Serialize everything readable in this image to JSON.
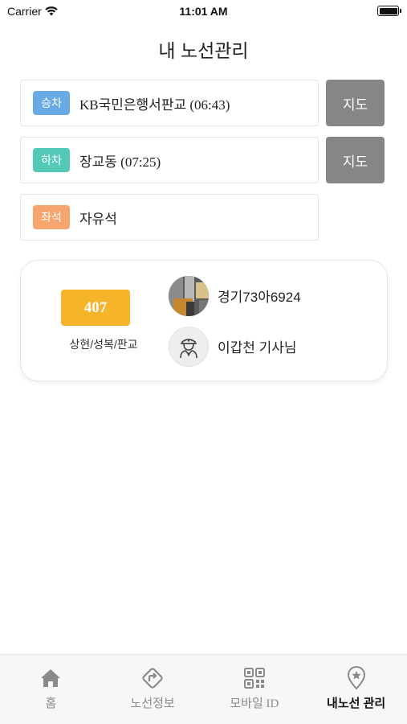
{
  "status_bar": {
    "carrier": "Carrier",
    "time": "11:01 AM",
    "battery_level": 1.0
  },
  "header": {
    "title": "내 노선관리"
  },
  "rows": [
    {
      "tag": "승차",
      "tag_color": "#6aaae4",
      "text": "KB국민은행서판교 (06:43)",
      "map_label": "지도"
    },
    {
      "tag": "하차",
      "tag_color": "#55c9b8",
      "text": "장교동 (07:25)",
      "map_label": "지도"
    },
    {
      "tag": "좌석",
      "tag_color": "#f7a46e",
      "text": "자유석"
    }
  ],
  "card": {
    "route_number": "407",
    "route_color": "#f6b42b",
    "route_desc": "상현/성복/판교",
    "plate": "경기73아6924",
    "driver": "이갑천 기사님"
  },
  "tab_bar": {
    "tabs": [
      {
        "label": "홈",
        "icon": "home-icon",
        "active": false
      },
      {
        "label": "노선정보",
        "icon": "route-direction-icon",
        "active": false
      },
      {
        "label": "모바일 ID",
        "icon": "qr-code-icon",
        "active": false
      },
      {
        "label": "내노선 관리",
        "icon": "location-pin-icon",
        "active": true
      }
    ]
  }
}
